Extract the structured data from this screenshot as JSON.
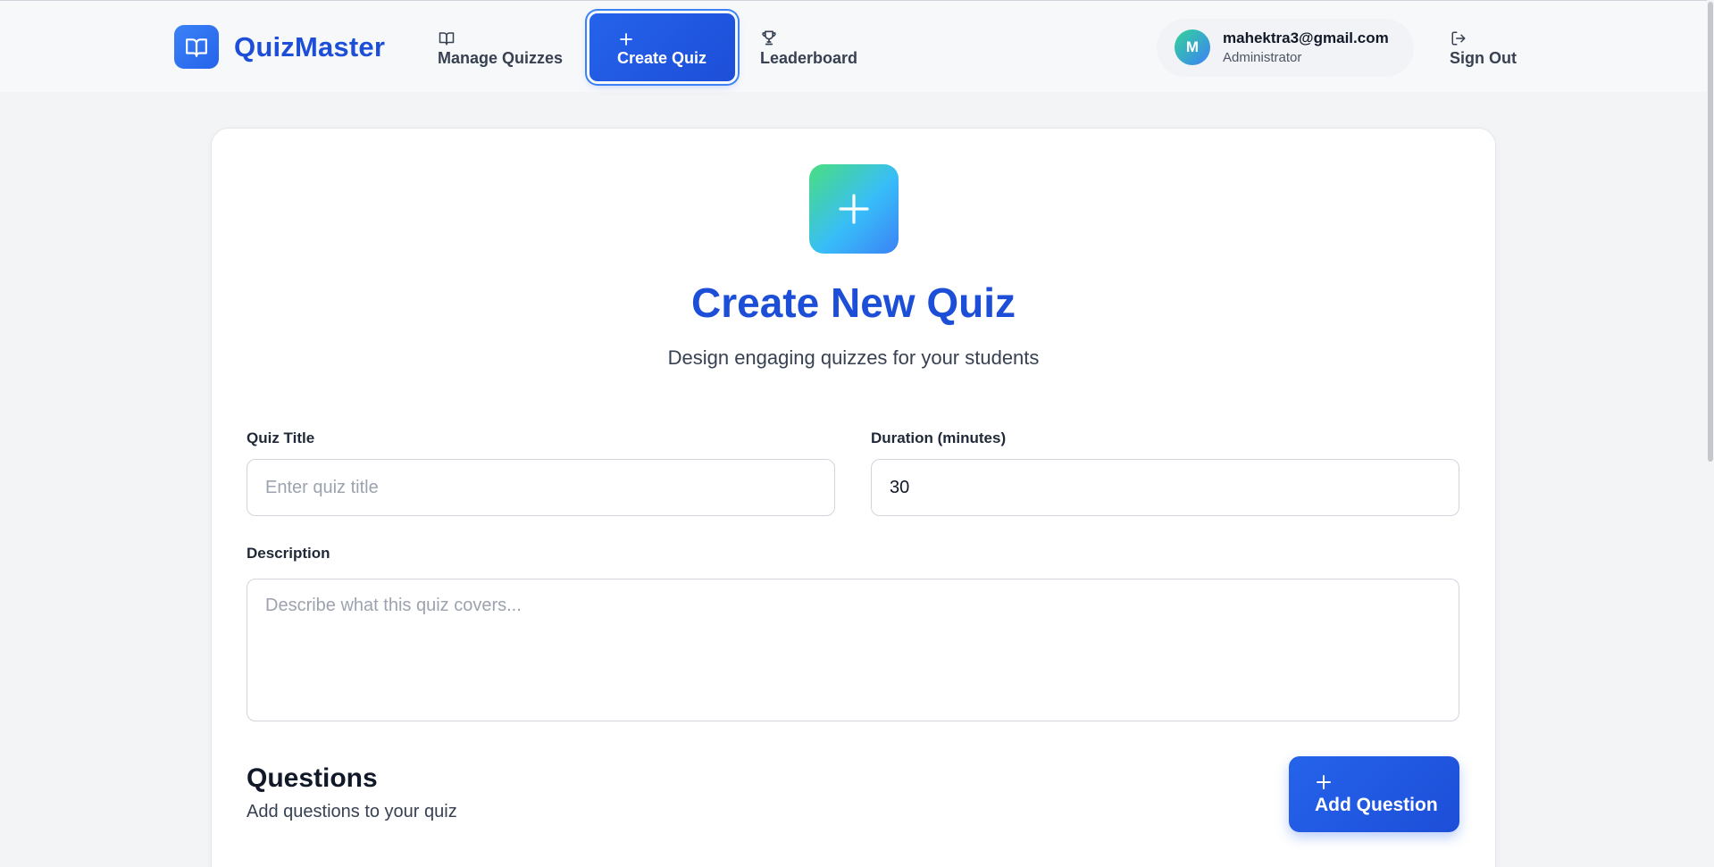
{
  "header": {
    "brand_name": "QuizMaster",
    "nav": [
      {
        "label": "Manage Quizzes",
        "icon": "book-open-icon"
      },
      {
        "label": "Create Quiz",
        "icon": "plus-icon",
        "active": true
      },
      {
        "label": "Leaderboard",
        "icon": "trophy-icon"
      }
    ],
    "user": {
      "avatar_initial": "M",
      "email": "mahektra3@gmail.com",
      "role": "Administrator"
    },
    "sign_out_label": "Sign Out"
  },
  "main": {
    "title": "Create New Quiz",
    "subtitle": "Design engaging quizzes for your students",
    "form": {
      "quiz_title_label": "Quiz Title",
      "quiz_title_placeholder": "Enter quiz title",
      "quiz_title_value": "",
      "duration_label": "Duration (minutes)",
      "duration_value": "30",
      "description_label": "Description",
      "description_placeholder": "Describe what this quiz covers..."
    },
    "questions": {
      "title": "Questions",
      "subtitle": "Add questions to your quiz",
      "add_button_label": "Add Question"
    }
  },
  "colors": {
    "brand": "#1d4ed8",
    "accent": "#2563eb",
    "hero_gradient_start": "#4ade80",
    "hero_gradient_end": "#3b82f6"
  }
}
